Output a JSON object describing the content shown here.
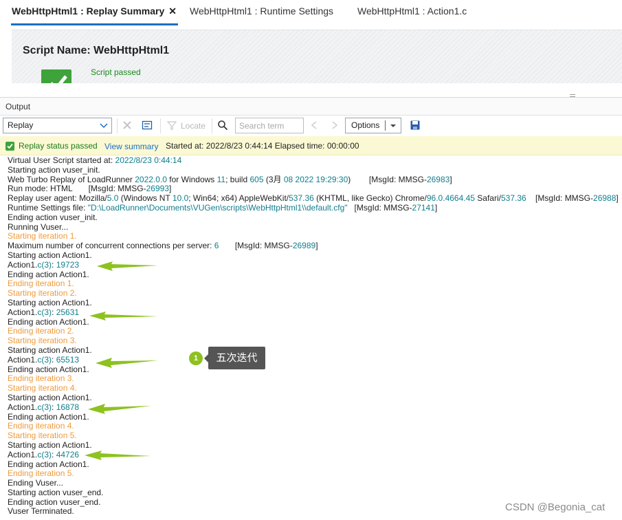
{
  "tabs": [
    {
      "label": "WebHttpHtml1 : Replay Summary",
      "active": true
    },
    {
      "label": "WebHttpHtml1 : Runtime Settings",
      "active": false
    },
    {
      "label": "WebHttpHtml1 : Action1.c",
      "active": false
    }
  ],
  "tab_close": "✕",
  "summary": {
    "script_name": "Script Name: WebHttpHtml1",
    "status_text": "Script passed"
  },
  "output": {
    "title": "Output",
    "replay_select": "Replay",
    "locate_label": "Locate",
    "search_placeholder": "Search term",
    "options_label": "Options"
  },
  "status_bar": {
    "status": "Replay status passed",
    "view_summary": "View summary",
    "started": "Started at: 2022/8/23 0:44:14 Elapsed time: 00:00:00"
  },
  "log_lines": [
    [
      {
        "t": "Virtual User Script started at: "
      },
      {
        "t": "2022/8/23 0:44:14",
        "c": "teal"
      }
    ],
    [
      {
        "t": "Starting action vuser_init."
      }
    ],
    [
      {
        "t": "Web Turbo Replay of LoadRunner "
      },
      {
        "t": "2022.0.0",
        "c": "teal"
      },
      {
        "t": " for Windows "
      },
      {
        "t": "11",
        "c": "teal"
      },
      {
        "t": "; build "
      },
      {
        "t": "605",
        "c": "teal"
      },
      {
        "t": " (3月 "
      },
      {
        "t": "08 2022 19:29:30",
        "c": "teal"
      },
      {
        "t": ")        [MsgId: MMSG-"
      },
      {
        "t": "26983",
        "c": "teal"
      },
      {
        "t": "]"
      }
    ],
    [
      {
        "t": "Run mode: HTML       [MsgId: MMSG-"
      },
      {
        "t": "26993",
        "c": "teal"
      },
      {
        "t": "]"
      }
    ],
    [
      {
        "t": "Replay user agent: Mozilla/"
      },
      {
        "t": "5.0",
        "c": "teal"
      },
      {
        "t": " (Windows NT "
      },
      {
        "t": "10.0",
        "c": "teal"
      },
      {
        "t": "; Win64; x64) AppleWebKit/"
      },
      {
        "t": "537.36",
        "c": "teal"
      },
      {
        "t": " (KHTML, like Gecko) Chrome/"
      },
      {
        "t": "96.0.4664.45",
        "c": "teal"
      },
      {
        "t": " Safari/"
      },
      {
        "t": "537.36",
        "c": "teal"
      },
      {
        "t": "    [MsgId: MMSG-"
      },
      {
        "t": "26988",
        "c": "teal"
      },
      {
        "t": "]"
      }
    ],
    [
      {
        "t": "Runtime Settings file: "
      },
      {
        "t": "\"D:\\LoadRunner\\Documents\\VUGen\\scripts\\WebHttpHtml1\\\\default.cfg\"",
        "c": "teal"
      },
      {
        "t": "   [MsgId: MMSG-"
      },
      {
        "t": "27141",
        "c": "teal"
      },
      {
        "t": "]"
      }
    ],
    [
      {
        "t": "Ending action vuser_init."
      }
    ],
    [
      {
        "t": "Running Vuser..."
      }
    ],
    [
      {
        "t": "Starting iteration 1.",
        "c": "orange"
      }
    ],
    [
      {
        "t": "Maximum number of concurrent connections per server: "
      },
      {
        "t": "6",
        "c": "teal"
      },
      {
        "t": "       [MsgId: MMSG-"
      },
      {
        "t": "26989",
        "c": "teal"
      },
      {
        "t": "]"
      }
    ],
    [
      {
        "t": "Starting action Action1."
      }
    ],
    [
      {
        "t": "Action1."
      },
      {
        "t": "c(3)",
        "c": "teal"
      },
      {
        "t": ": "
      },
      {
        "t": "19723",
        "c": "teal"
      }
    ],
    [
      {
        "t": "Ending action Action1."
      }
    ],
    [
      {
        "t": "Ending iteration 1.",
        "c": "orange"
      }
    ],
    [
      {
        "t": "Starting iteration 2.",
        "c": "orange"
      }
    ],
    [
      {
        "t": "Starting action Action1."
      }
    ],
    [
      {
        "t": "Action1."
      },
      {
        "t": "c(3)",
        "c": "teal"
      },
      {
        "t": ": "
      },
      {
        "t": "25631",
        "c": "teal"
      }
    ],
    [
      {
        "t": "Ending action Action1."
      }
    ],
    [
      {
        "t": "Ending iteration 2.",
        "c": "orange"
      }
    ],
    [
      {
        "t": "Starting iteration 3.",
        "c": "orange"
      }
    ],
    [
      {
        "t": "Starting action Action1."
      }
    ],
    [
      {
        "t": "Action1."
      },
      {
        "t": "c(3)",
        "c": "teal"
      },
      {
        "t": ": "
      },
      {
        "t": "65513",
        "c": "teal"
      }
    ],
    [
      {
        "t": "Ending action Action1."
      }
    ],
    [
      {
        "t": "Ending iteration 3.",
        "c": "orange"
      }
    ],
    [
      {
        "t": "Starting iteration 4.",
        "c": "orange"
      }
    ],
    [
      {
        "t": "Starting action Action1."
      }
    ],
    [
      {
        "t": "Action1."
      },
      {
        "t": "c(3)",
        "c": "teal"
      },
      {
        "t": ": "
      },
      {
        "t": "16878",
        "c": "teal"
      }
    ],
    [
      {
        "t": "Ending action Action1."
      }
    ],
    [
      {
        "t": "Ending iteration 4.",
        "c": "orange"
      }
    ],
    [
      {
        "t": "Starting iteration 5.",
        "c": "orange"
      }
    ],
    [
      {
        "t": "Starting action Action1."
      }
    ],
    [
      {
        "t": "Action1."
      },
      {
        "t": "c(3)",
        "c": "teal"
      },
      {
        "t": ": "
      },
      {
        "t": "44726",
        "c": "teal"
      }
    ],
    [
      {
        "t": "Ending action Action1."
      }
    ],
    [
      {
        "t": "Ending iteration 5.",
        "c": "orange"
      }
    ],
    [
      {
        "t": "Ending Vuser..."
      }
    ],
    [
      {
        "t": "Starting action vuser_end."
      }
    ],
    [
      {
        "t": "Ending action vuser_end."
      }
    ],
    [
      {
        "t": "Vuser Terminated."
      }
    ]
  ],
  "annotation": {
    "number": "1",
    "label": "五次迭代",
    "arrow_color": "#8dc21f"
  },
  "watermark": "CSDN @Begonia_cat",
  "colors": {
    "accent": "#1a6fc4",
    "pass_green": "#3ea33a",
    "log_teal": "#0f7e8c",
    "log_orange": "#ef9a3a",
    "status_bg": "#fbf9d3"
  }
}
